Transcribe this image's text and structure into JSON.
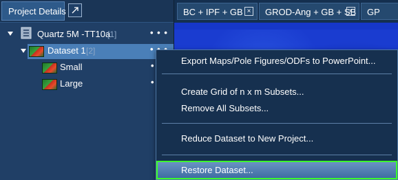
{
  "panel": {
    "title": "Project Details",
    "popout_icon": "popout-icon"
  },
  "tree": {
    "project": {
      "label": "Quartz 5M -TT10a",
      "count": "[1]",
      "icon": "project-file-icon",
      "menu": "• • •"
    },
    "dataset": {
      "label": "Dataset 1",
      "count": "[2]",
      "icon": "dataset-map-icon",
      "menu": "• • •"
    },
    "subsets": [
      {
        "label": "Small",
        "icon": "subset-map-icon",
        "menu": "•"
      },
      {
        "label": "Large",
        "icon": "subset-map-icon",
        "menu": "•"
      }
    ]
  },
  "tabs": [
    {
      "label": "BC + IPF + GB",
      "close": "×"
    },
    {
      "label": "GROD-Ang + GB + SB",
      "close": "×"
    },
    {
      "label": "GP"
    }
  ],
  "context_menu": {
    "items": [
      {
        "label": "Export Maps/Pole Figures/ODFs to PowerPoint..."
      },
      {
        "label": "Create Grid of n x m Subsets..."
      },
      {
        "label": "Remove All Subsets..."
      },
      {
        "label": "Reduce Dataset to New Project..."
      },
      {
        "label": "Restore Dataset...",
        "highlighted": true
      }
    ]
  },
  "colors": {
    "highlight_border": "#3cff2c",
    "selection": "#4a7fb8",
    "map_blue": "#1a3cd0"
  }
}
